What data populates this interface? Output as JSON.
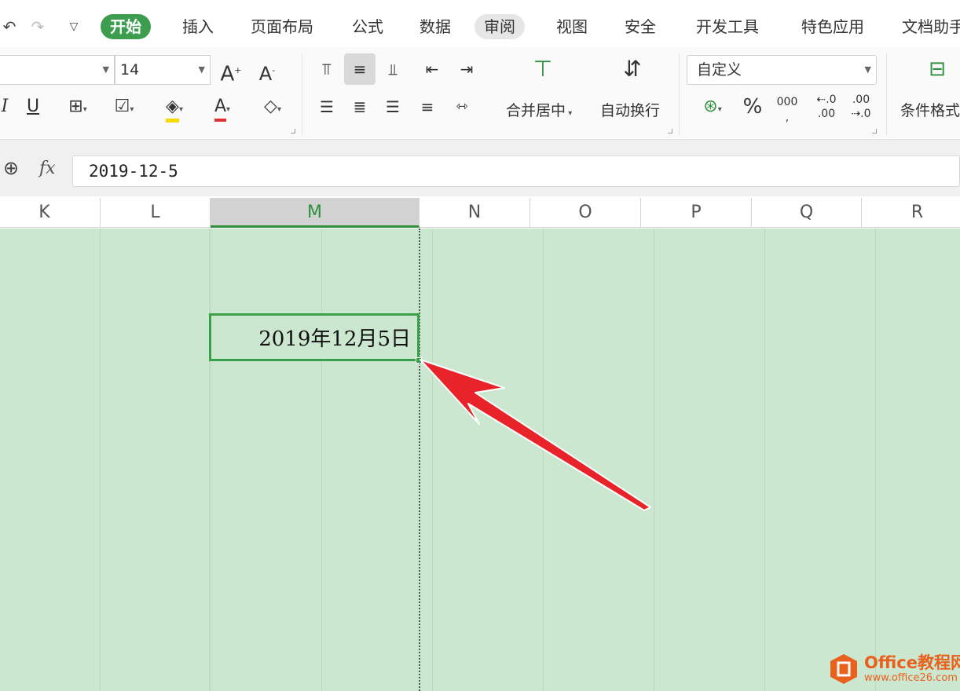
{
  "quick_access": {
    "undo_icon": "undo-icon",
    "redo_icon": "redo-icon",
    "more_icon": "chevron-down-icon"
  },
  "tabs": [
    {
      "label": "开始",
      "state": "active"
    },
    {
      "label": "插入"
    },
    {
      "label": "页面布局"
    },
    {
      "label": "公式"
    },
    {
      "label": "数据"
    },
    {
      "label": "审阅",
      "state": "hover"
    },
    {
      "label": "视图"
    },
    {
      "label": "安全"
    },
    {
      "label": "开发工具"
    },
    {
      "label": "特色应用"
    },
    {
      "label": "文档助手"
    }
  ],
  "ribbon": {
    "font_size_value": "14",
    "number_format_value": "自定义",
    "merge_center_label": "合并居中",
    "wrap_text_label": "自动换行",
    "percent_label": "%",
    "thousands_label": "000",
    "conditional_format_label": "条件格式",
    "increase_font_label": "A",
    "decrease_font_label": "A",
    "underline_label": "U",
    "font_color_label": "A",
    "font_color_bar": "#e03030",
    "highlight_color_bar": "#f5d800"
  },
  "formula_bar": {
    "fx_label": "fx",
    "value": "2019-12-5"
  },
  "columns": [
    "K",
    "L",
    "M",
    "N",
    "O",
    "P",
    "Q",
    "R"
  ],
  "selected_column": "M",
  "cell": {
    "display": "2019年12月5日"
  },
  "colors": {
    "accent_green": "#3c9d4e",
    "sheet_background": "#cce7cf",
    "arrow_red": "#e8242a"
  },
  "watermark": {
    "name": "Office教程网",
    "url": "www.office26.com"
  }
}
